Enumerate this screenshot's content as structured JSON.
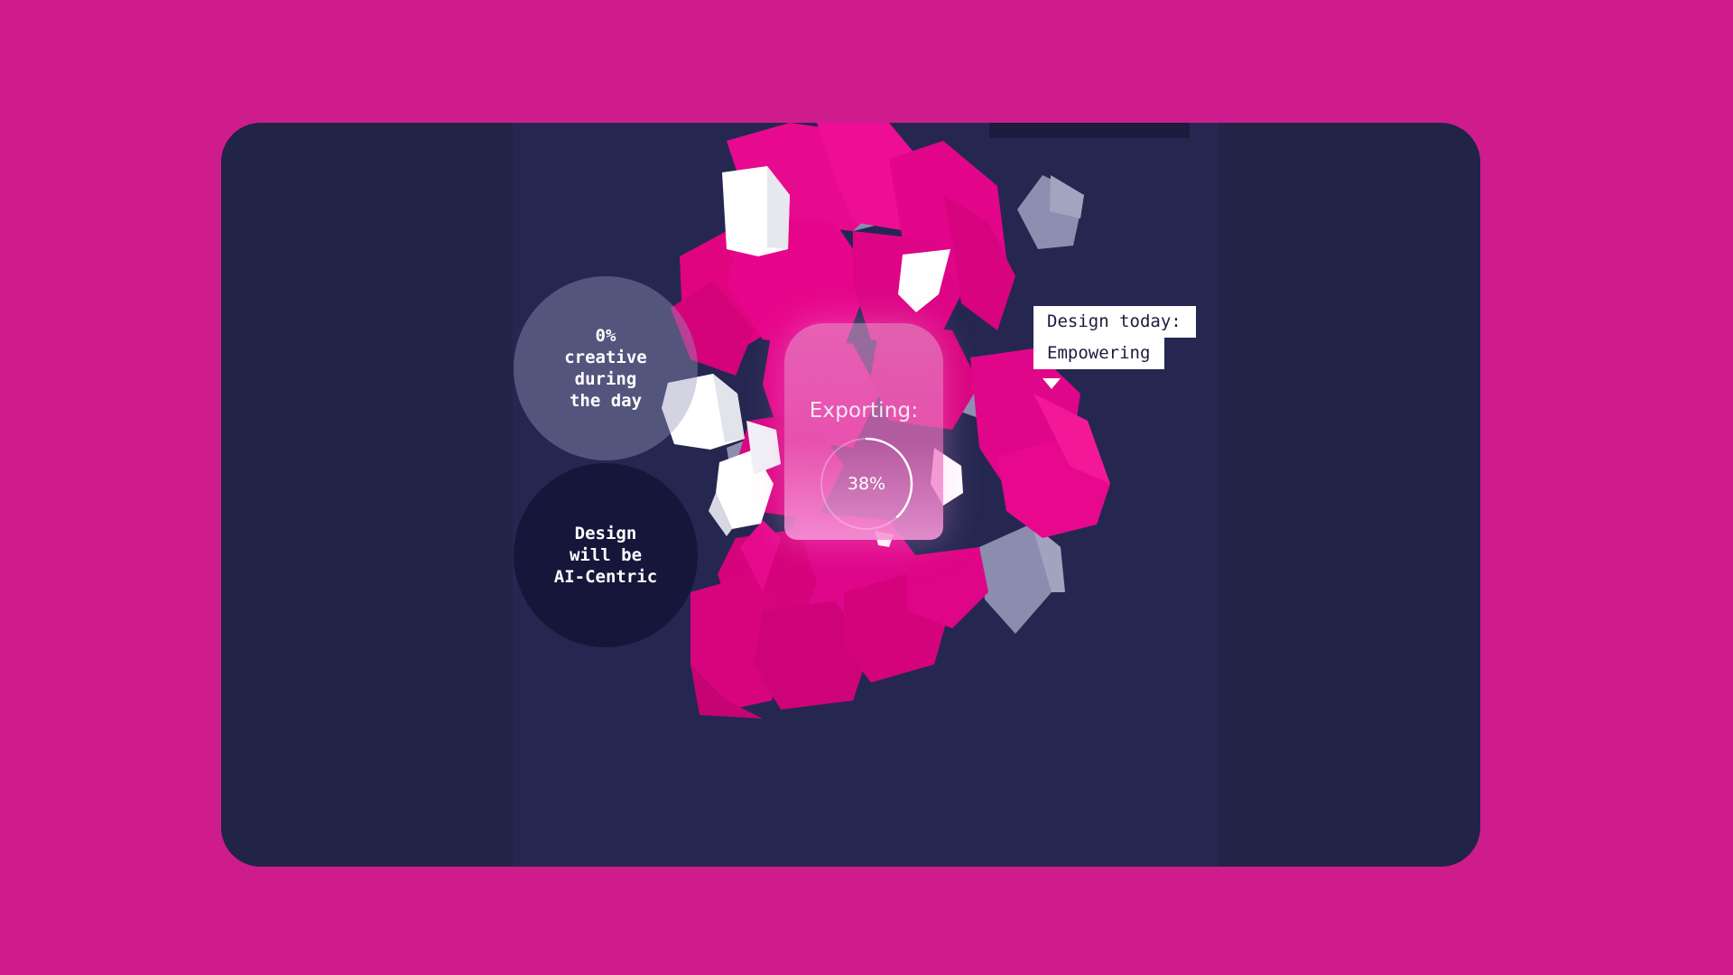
{
  "bubbles": {
    "creative_text": "0%\ncreative\nduring\nthe day",
    "ai_text": "Design\nwill be\nAI-Centric"
  },
  "export": {
    "label": "Exporting:",
    "progress_text": "38%",
    "progress_fraction": 0.38
  },
  "tooltip": {
    "line1": "Design today:",
    "line2": "Empowering"
  },
  "colors": {
    "background": "#cf1c8c",
    "card": "#252751",
    "cube_pink": "#e8068e",
    "cube_grey": "#9a9ab6",
    "cube_white": "#ffffff"
  }
}
